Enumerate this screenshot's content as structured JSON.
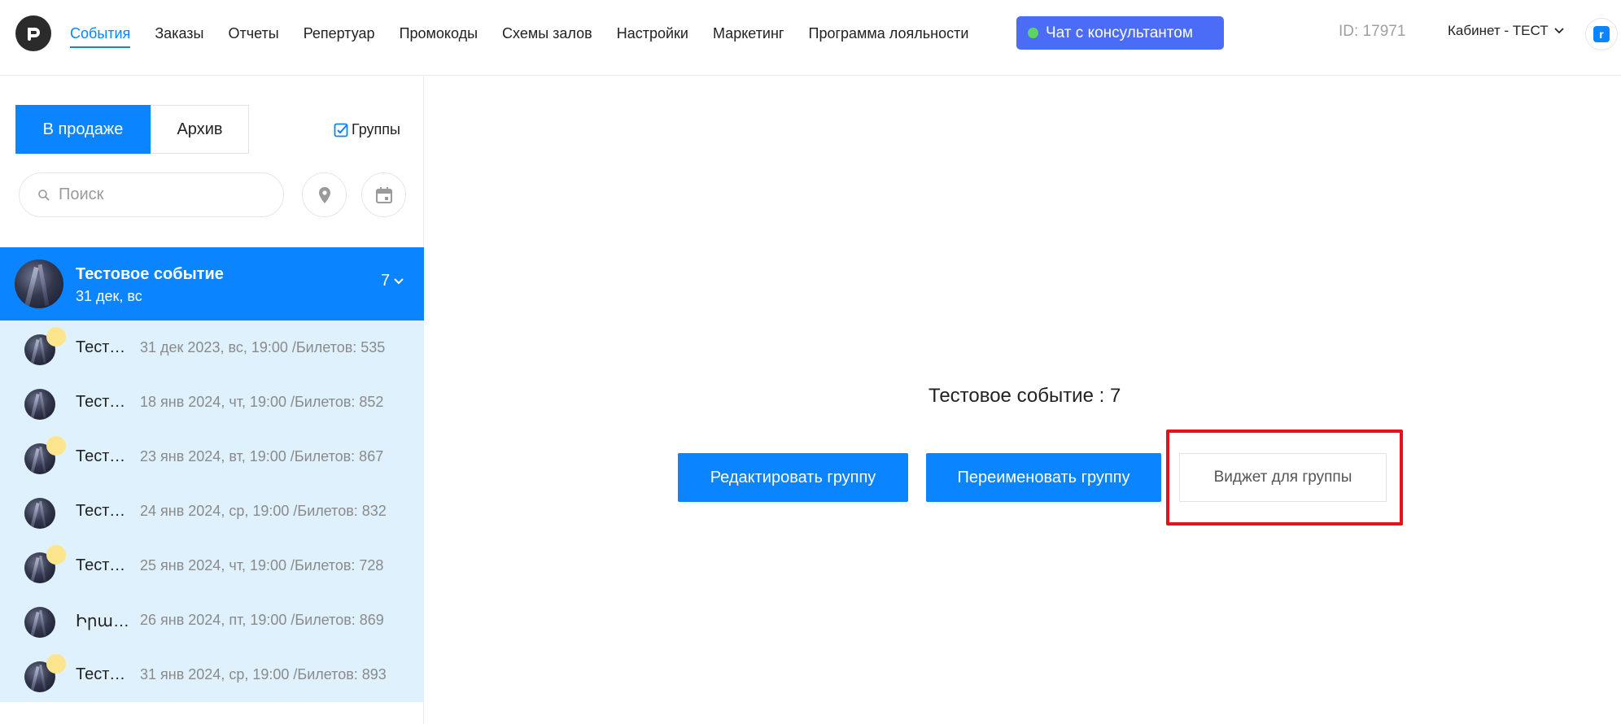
{
  "header": {
    "nav": [
      "События",
      "Заказы",
      "Отчеты",
      "Репертуар",
      "Промокоды",
      "Схемы залов",
      "Настройки",
      "Маркетинг",
      "Программа лояльности"
    ],
    "active_nav": "События",
    "chat_label": "Чат с консультантом",
    "user_id": "ID: 17971",
    "cabinet": "Кабинет - ТЕСТ"
  },
  "sidebar": {
    "tab_sale": "В продаже",
    "tab_archive": "Архив",
    "groups_label": "Группы",
    "search_placeholder": "Поиск",
    "group": {
      "title": "Тестовое событие",
      "date": "31 дек, вс",
      "count": "7"
    },
    "events": [
      {
        "name": "Тестовое событие",
        "info": "31 дек 2023, вс, 19:00 /Билетов: 535",
        "dot": true
      },
      {
        "name": "Тестовое событие",
        "info": "18 янв 2024, чт, 19:00 /Билетов: 852",
        "dot": false
      },
      {
        "name": "Тестовое событие",
        "info": "23 янв 2024, вт, 19:00 /Билетов: 867",
        "dot": true
      },
      {
        "name": "Тестовое событие",
        "info": "24 янв 2024, ср, 19:00 /Билетов: 832",
        "dot": false
      },
      {
        "name": "Тестовое событие",
        "info": "25 янв 2024, чт, 19:00 /Билетов: 728",
        "dot": true
      },
      {
        "name": "Իրադարձություն",
        "info": "26 янв 2024, пт, 19:00 /Билетов: 869",
        "dot": false
      },
      {
        "name": "Тестовое событие",
        "info": "31 янв 2024, ср, 19:00 /Билетов: 893",
        "dot": true
      }
    ]
  },
  "main": {
    "title": "Тестовое событие : 7",
    "edit_group": "Редактировать группу",
    "rename_group": "Переименовать группу",
    "widget_group": "Виджет для группы"
  },
  "colors": {
    "primary": "#0a84ff",
    "chat_button": "#4a6cf7",
    "highlight": "#e8101a",
    "event_row_bg": "#dff1fd"
  }
}
